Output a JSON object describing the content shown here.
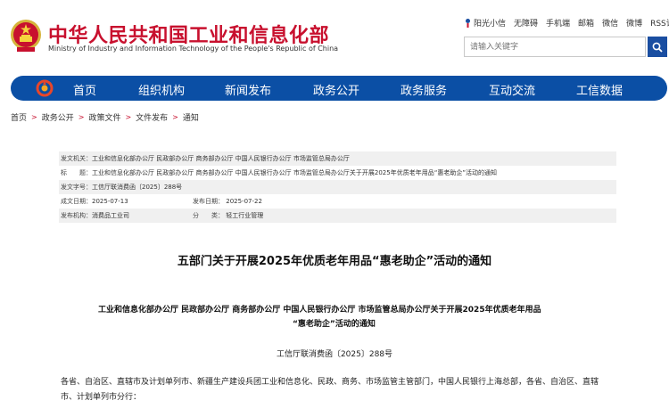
{
  "header": {
    "title": "中华人民共和国工业和信息化部",
    "subtitle": "Ministry of Industry and Information Technology of the People's Republic of China",
    "top_links": [
      "阳光小信",
      "无障碍",
      "手机端",
      "邮箱",
      "微信",
      "微博",
      "RSS订阅"
    ],
    "search_placeholder": "请输入关键字"
  },
  "nav": {
    "items": [
      "首页",
      "组织机构",
      "新闻发布",
      "政务公开",
      "政务服务",
      "互动交流",
      "工信数据"
    ]
  },
  "breadcrumb": [
    "首页",
    "政务公开",
    "政策文件",
    "文件发布",
    "通知"
  ],
  "meta": {
    "issuer_label": "发文机关：",
    "issuer_value": "工业和信息化部办公厅 民政部办公厅 商务部办公厅 中国人民银行办公厅 市场监管总局办公厅",
    "title_label": "标　　题：",
    "title_value": "工业和信息化部办公厅 民政部办公厅 商务部办公厅 中国人民银行办公厅 市场监管总局办公厅关于开展2025年优质老年用品“惠老助企”活动的通知",
    "docno_label": "发文字号：",
    "docno_value": "工信厅联消费函〔2025〕288号",
    "date_label": "成文日期：",
    "date_value": "2025-07-13",
    "pubdate_label": "发布日期：",
    "pubdate_value": "2025-07-22",
    "org_label": "发布机构：",
    "org_value": "消费品工业司",
    "cat_label": "分　　类：",
    "cat_value": "轻工行业管理"
  },
  "document": {
    "title": "五部门关于开展2025年优质老年用品“惠老助企”活动的通知",
    "issuer_line1": "工业和信息化部办公厅  民政部办公厅  商务部办公厅  中国人民银行办公厅  市场监管总局办公厅关于开展2025年优质老年用品",
    "issuer_line2": "“惠老助企”活动的通知",
    "doc_number": "工信厅联消费函〔2025〕288号",
    "body_line1": "各省、自治区、直辖市及计划单列市、新疆生产建设兵团工业和信息化、民政、商务、市场监管主管部门，中国人民银行上海总部，各省、自治区、直辖",
    "body_line2": "市、计划单列市分行："
  },
  "colors": {
    "brand_red": "#c8102e",
    "nav_blue": "#0b4fa5",
    "search_blue": "#1a4ea1"
  }
}
